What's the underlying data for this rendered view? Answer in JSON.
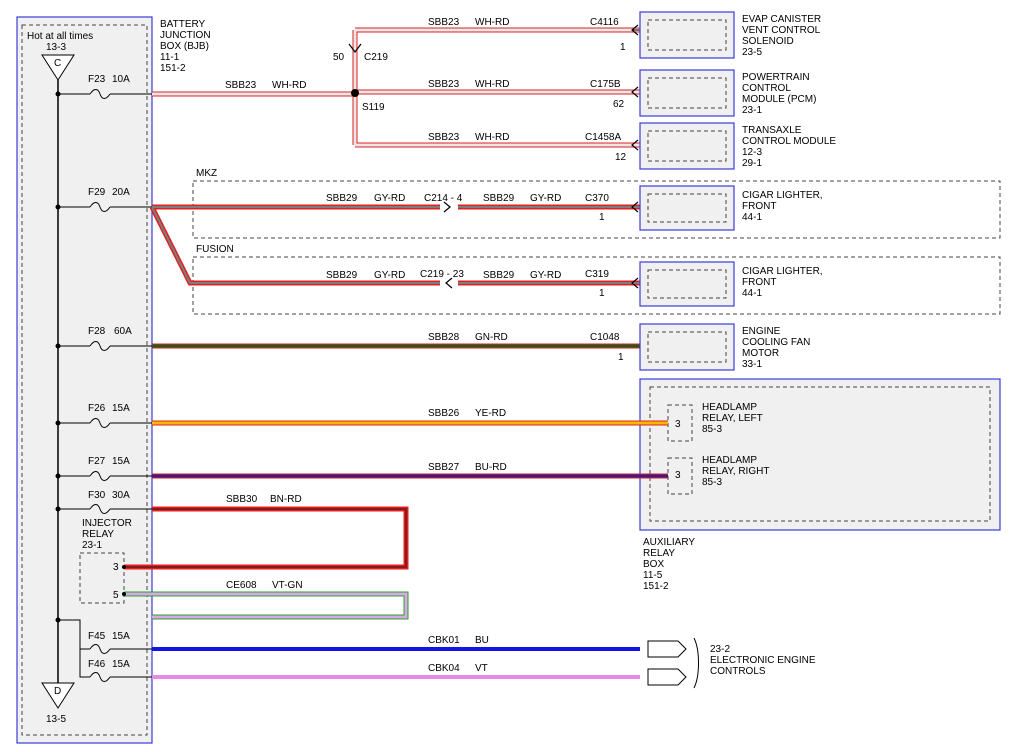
{
  "colors": {
    "box_border": "#3b3bd6",
    "box_fill": "#f0f0f0",
    "wire_wh_rd": "#e8e8e8",
    "wire_gy_rd": "#7d7d7d",
    "wire_gn_rd": "#1f5c18",
    "wire_ye_rd": "#f5b800",
    "wire_bu_rd": "#3a1a8a",
    "wire_bn_rd": "#8a1a1a",
    "wire_vt_gn": "#d8a8e8",
    "wire_bu": "#1414e0",
    "wire_vt": "#e68ae6",
    "stripe_red": "#e02020",
    "stripe_gn": "#2aa02a"
  },
  "bjb": {
    "hot_label": "Hot at all times",
    "ref_top": "13-3",
    "arrow_top": "C",
    "arrow_bottom": "D",
    "ref_bottom": "13-5",
    "title_lines": [
      "BATTERY",
      "JUNCTION",
      "BOX (BJB)",
      "11-1",
      "151-2"
    ]
  },
  "fuses": [
    {
      "id": "F23",
      "amps": "10A"
    },
    {
      "id": "F29",
      "amps": "20A"
    },
    {
      "id": "F28",
      "amps": "60A"
    },
    {
      "id": "F26",
      "amps": "15A"
    },
    {
      "id": "F27",
      "amps": "15A"
    },
    {
      "id": "F30",
      "amps": "30A"
    },
    {
      "id": "F45",
      "amps": "15A"
    },
    {
      "id": "F46",
      "amps": "15A"
    }
  ],
  "injector_relay": {
    "lines": [
      "INJECTOR",
      "RELAY",
      "23-1"
    ],
    "pin3": "3",
    "pin5": "5"
  },
  "splice": {
    "connector": "C219",
    "connector_pin": "50",
    "splice_id": "S119"
  },
  "wires": {
    "sbb23": {
      "circuit": "SBB23",
      "color": "WH-RD"
    },
    "sbb29": {
      "circuit": "SBB29",
      "color": "GY-RD"
    },
    "sbb28": {
      "circuit": "SBB28",
      "color": "GN-RD"
    },
    "sbb26": {
      "circuit": "SBB26",
      "color": "YE-RD"
    },
    "sbb27": {
      "circuit": "SBB27",
      "color": "BU-RD"
    },
    "sbb30": {
      "circuit": "SBB30",
      "color": "BN-RD"
    },
    "ce608": {
      "circuit": "CE608",
      "color": "VT-GN"
    },
    "cbk01": {
      "circuit": "CBK01",
      "color": "BU"
    },
    "cbk04": {
      "circuit": "CBK04",
      "color": "VT"
    }
  },
  "connectors": {
    "c4116": {
      "name": "C4116",
      "pin": "1"
    },
    "c175b": {
      "name": "C175B",
      "pin": "62"
    },
    "c1458a": {
      "name": "C1458A",
      "pin": "12"
    },
    "c214": {
      "name": "C214 - 4"
    },
    "c370": {
      "name": "C370",
      "pin": "1"
    },
    "c219_23": {
      "name": "C219 - 23"
    },
    "c319": {
      "name": "C319",
      "pin": "1"
    },
    "c1048": {
      "name": "C1048",
      "pin": "1"
    }
  },
  "variants": {
    "mkz": "MKZ",
    "fusion": "FUSION"
  },
  "components": {
    "evap": [
      "EVAP CANISTER",
      "VENT CONTROL",
      "SOLENOID",
      "23-5"
    ],
    "pcm": [
      "POWERTRAIN",
      "CONTROL",
      "MODULE (PCM)",
      "23-1"
    ],
    "tcm": [
      "TRANSAXLE",
      "CONTROL MODULE",
      "12-3",
      "29-1"
    ],
    "cigar_mkz": [
      "CIGAR LIGHTER,",
      "FRONT",
      "44-1"
    ],
    "cigar_fusion": [
      "CIGAR LIGHTER,",
      "FRONT",
      "44-1"
    ],
    "fan": [
      "ENGINE",
      "COOLING FAN",
      "MOTOR",
      "33-1"
    ],
    "relay_left": {
      "pin": "3",
      "lines": [
        "HEADLAMP",
        "RELAY, LEFT",
        "85-3"
      ]
    },
    "relay_right": {
      "pin": "3",
      "lines": [
        "HEADLAMP",
        "RELAY, RIGHT",
        "85-3"
      ]
    },
    "aux_box": [
      "AUXILIARY",
      "RELAY",
      "BOX",
      "11-5",
      "151-2"
    ],
    "eec": [
      "23-2",
      "ELECTRONIC ENGINE",
      "CONTROLS"
    ]
  }
}
